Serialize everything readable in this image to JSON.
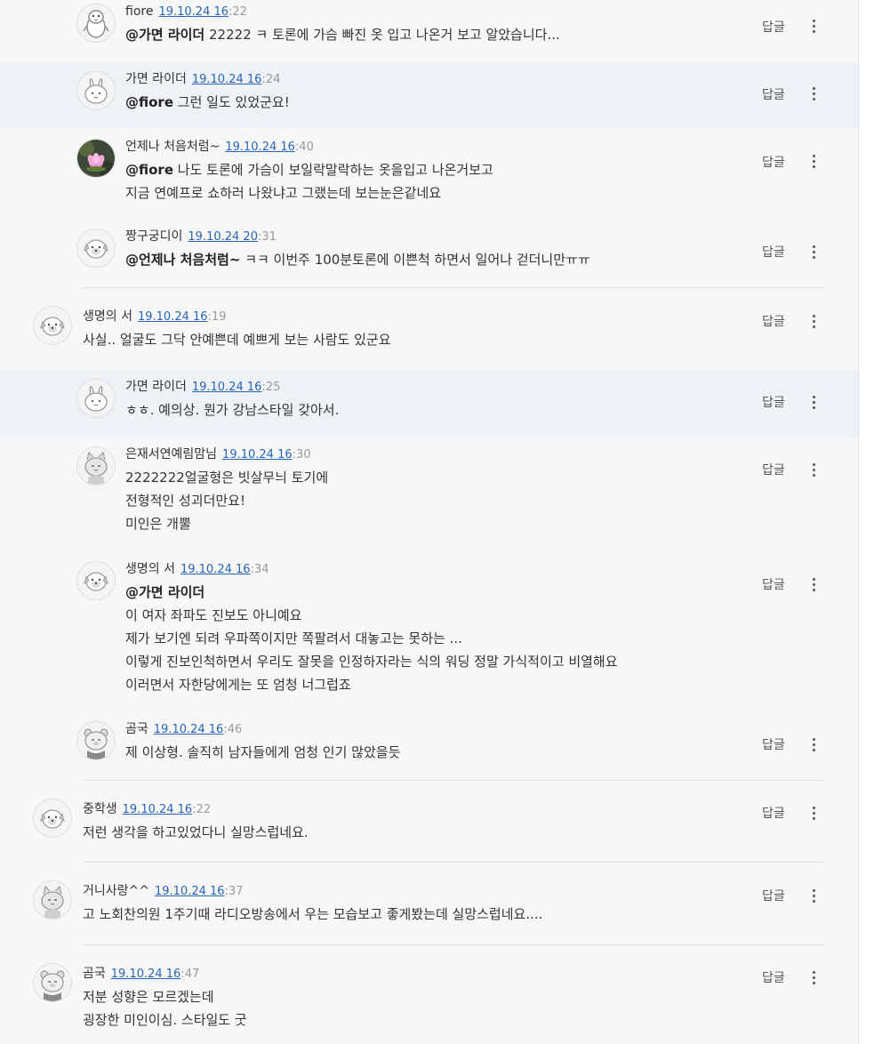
{
  "ui": {
    "reply_label": "답글",
    "more_icon": "more-vertical-icon"
  },
  "comments": [
    {
      "nick": "fiore",
      "date": "19.10.24 16",
      "sec": ":22",
      "mention": "@가면 라이더",
      "lines": [
        "22222 ㅋ 토론에 가슴 빠진 옷 입고 나온거 보고 알았습니다..."
      ],
      "avatar": "penguin-avatar-icon"
    },
    {
      "nick": "가면 라이더",
      "date": "19.10.24 16",
      "sec": ":24",
      "mention": "@fiore",
      "lines": [
        "그런 일도 있었군요!"
      ],
      "avatar": "rabbit-avatar-icon"
    },
    {
      "nick": "언제나 처음처럼~",
      "date": "19.10.24 16",
      "sec": ":40",
      "mention": "@fiore",
      "lines": [
        "나도 토론에 가슴이 보일락말락하는 옷을입고 나온거보고",
        "지금 연예프로 쇼하러 나왔냐고 그랬는데 보는눈은같네요"
      ],
      "avatar": "lotus-photo-avatar"
    },
    {
      "nick": "짱구궁디이",
      "date": "19.10.24 20",
      "sec": ":31",
      "mention": "@언제나 처음처럼~",
      "lines": [
        "ㅋㅋ 이번주 100분토론에 이쁜척 하면서 일어나 걷더니만ㅠㅠ"
      ],
      "avatar": "pug-avatar-icon"
    },
    {
      "nick": "생명의 서",
      "date": "19.10.24 16",
      "sec": ":19",
      "mention": "",
      "lines": [
        "사실.. 얼굴도 그닥 안예쁜데 예쁘게 보는 사람도 있군요"
      ],
      "avatar": "pug-avatar-icon"
    },
    {
      "nick": "가면 라이더",
      "date": "19.10.24 16",
      "sec": ":25",
      "mention": "",
      "lines": [
        "ㅎㅎ. 예의상. 뭔가 강남스타일 갖아서."
      ],
      "avatar": "rabbit-avatar-icon"
    },
    {
      "nick": "은재서연예림맘님",
      "date": "19.10.24 16",
      "sec": ":30",
      "mention": "",
      "lines": [
        "2222222얼굴형은 빗살무늬 토기에",
        "전형적인 성괴더만요!",
        "미인은 개뿔"
      ],
      "avatar": "cat-avatar-icon"
    },
    {
      "nick": "생명의 서",
      "date": "19.10.24 16",
      "sec": ":34",
      "mention": "@가면 라이더",
      "lines": [
        "이 여자 좌파도 진보도 아니예요",
        "제가 보기엔 되려 우파쪽이지만 쪽팔려서 대놓고는 못하는 ...",
        "이렇게 진보인척하면서 우리도 잘못을 인정하자라는 식의 워딩 정말 가식적이고 비열해요",
        "이러면서 자한당에게는 또 엄청 너그럽죠"
      ],
      "avatar": "pug-avatar-icon"
    },
    {
      "nick": "곰국",
      "date": "19.10.24 16",
      "sec": ":46",
      "mention": "",
      "lines": [
        "제 이상형. 솔직히 남자들에게 엄청 인기 많았을듯"
      ],
      "avatar": "bear-avatar-icon"
    },
    {
      "nick": "중학생",
      "date": "19.10.24 16",
      "sec": ":22",
      "mention": "",
      "lines": [
        "저런 생각을 하고있었다니 실망스럽네요."
      ],
      "avatar": "pug-avatar-icon"
    },
    {
      "nick": "거니사랑^^",
      "date": "19.10.24 16",
      "sec": ":37",
      "mention": "",
      "lines": [
        "고 노회찬의원 1주기때 라디오방송에서 우는 모습보고 좋게봤는데 실망스럽네요...."
      ],
      "avatar": "cat-avatar-icon"
    },
    {
      "nick": "곰국",
      "date": "19.10.24 16",
      "sec": ":47",
      "mention": "",
      "lines": [
        "저분 성향은 모르겠는데",
        "굉장한 미인이심. 스타일도 굿"
      ],
      "avatar": "bear-avatar-icon"
    }
  ]
}
